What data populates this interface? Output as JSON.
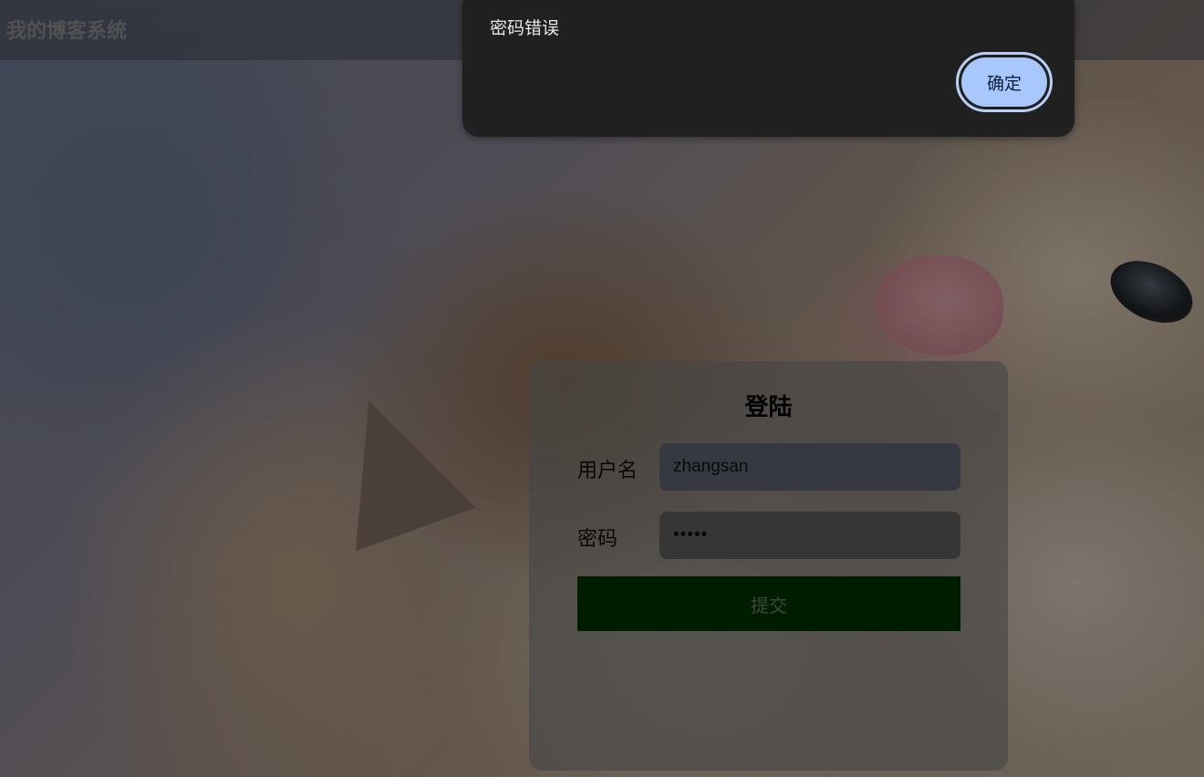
{
  "nav": {
    "title": "我的博客系统"
  },
  "background": {
    "icon": "cat-photo"
  },
  "login": {
    "title": "登陆",
    "username_label": "用户名",
    "username_value": "zhangsan",
    "password_label": "密码",
    "password_value": "•••••",
    "submit_label": "提交"
  },
  "alert": {
    "message": "密码错误",
    "ok_label": "确定"
  },
  "colors": {
    "submit_bg": "#003300",
    "alert_bg": "#202020",
    "alert_button": "#a8c7fa"
  }
}
